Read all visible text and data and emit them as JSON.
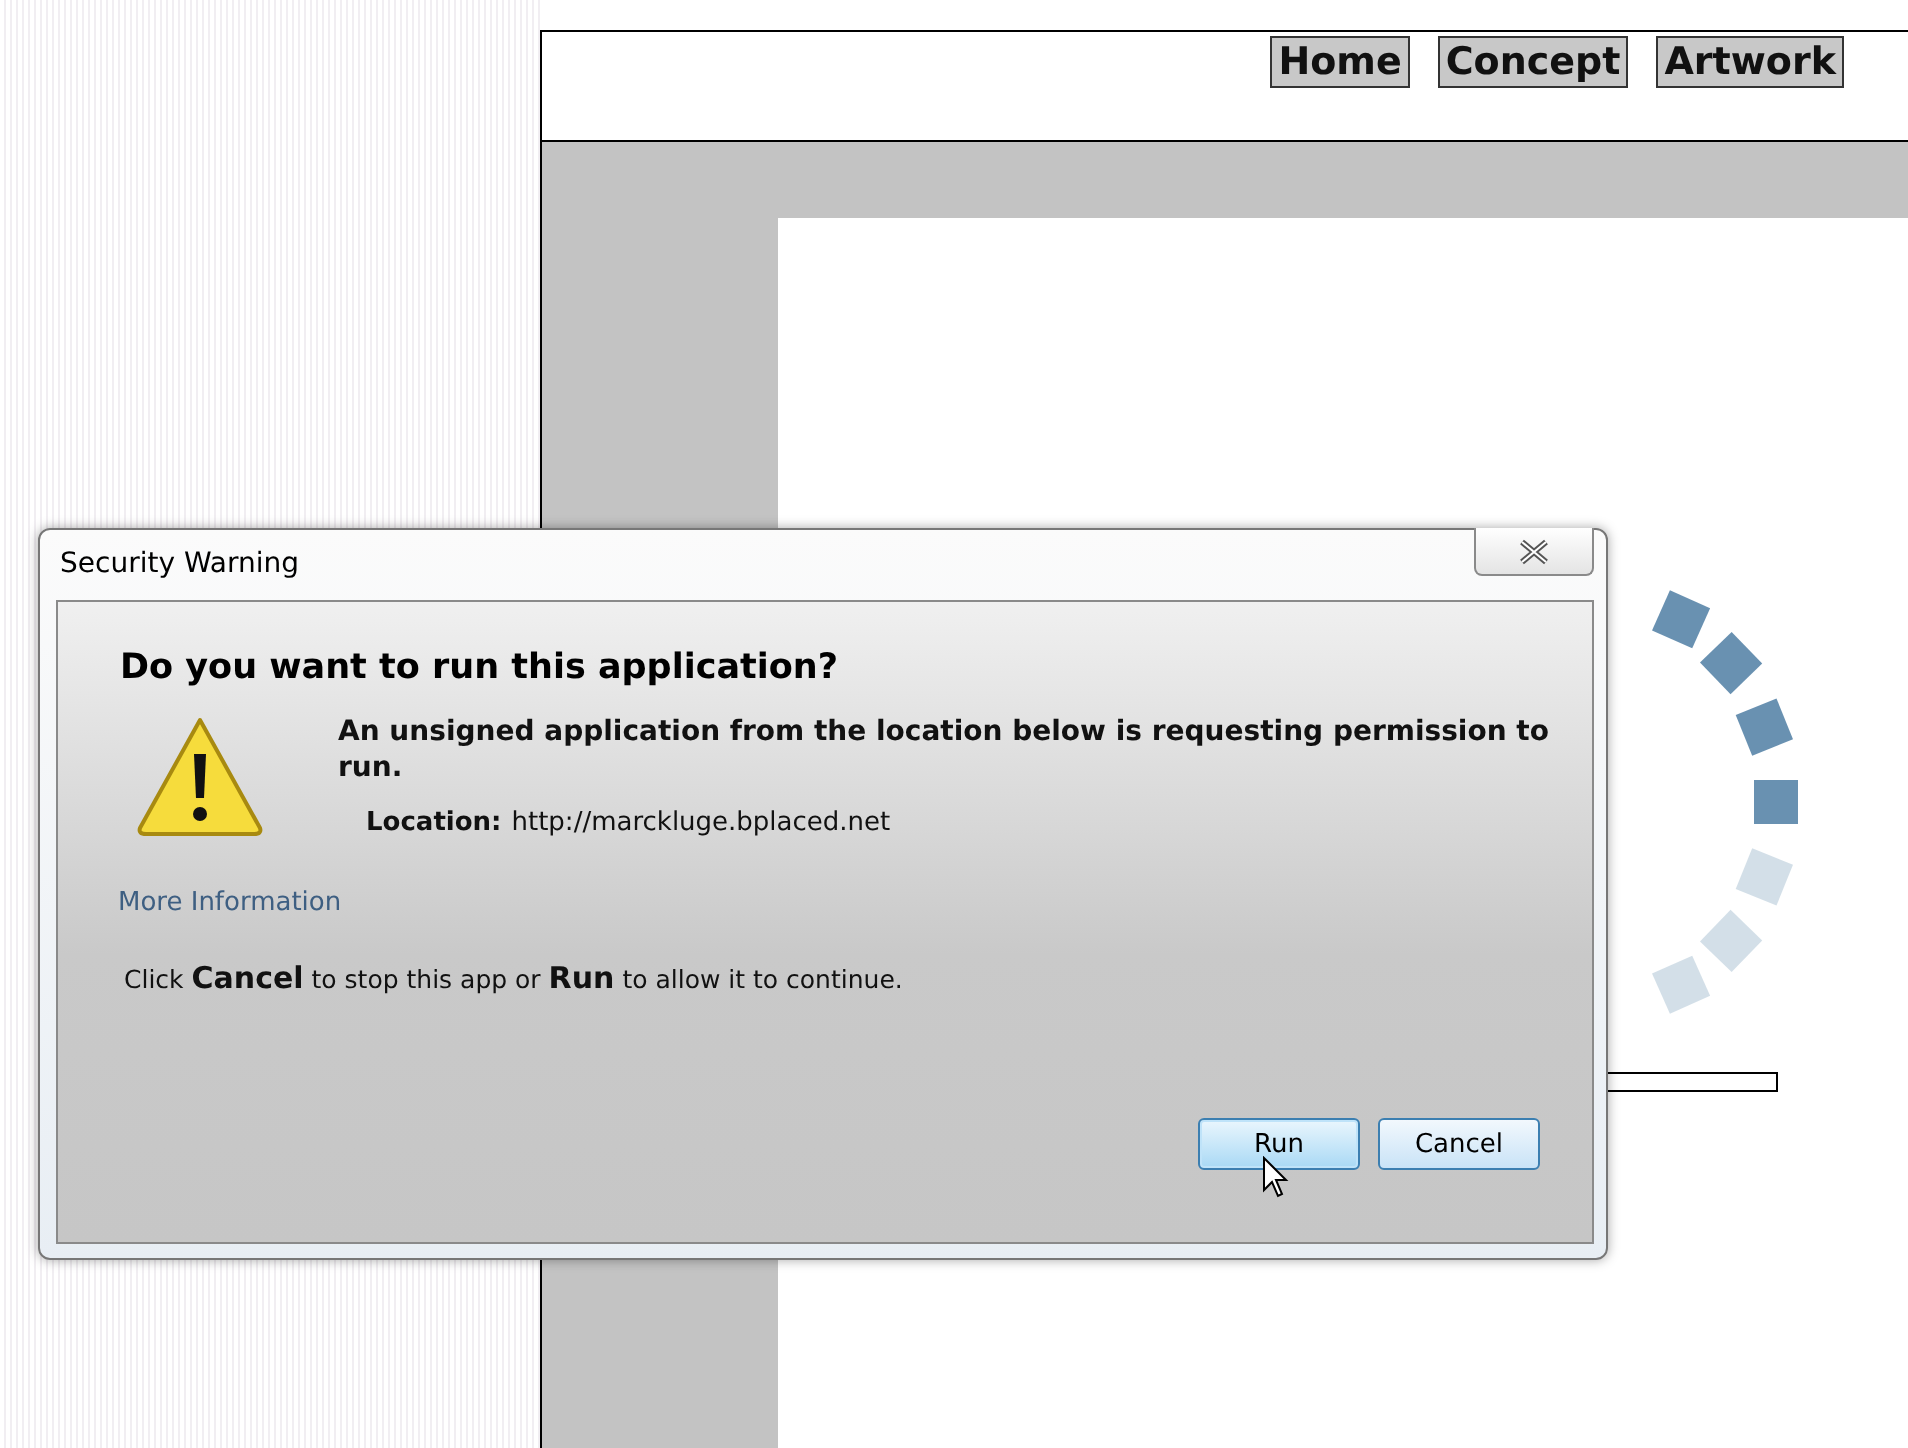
{
  "page": {
    "nav": [
      {
        "label": "Home"
      },
      {
        "label": "Concept"
      },
      {
        "label": "Artwork"
      }
    ]
  },
  "dialog": {
    "title": "Security Warning",
    "heading": "Do you want to run this application?",
    "message": "An unsigned application from the location below is requesting permission to run.",
    "location_label": "Location:",
    "location_value": "http://marckluge.bplaced.net",
    "more_info": "More Information",
    "instruction": "Click **Cancel** to stop this app or **Run** to allow it to continue.",
    "buttons": [
      {
        "label": "Run",
        "hovered": true
      },
      {
        "label": "Cancel",
        "hovered": false
      }
    ]
  }
}
